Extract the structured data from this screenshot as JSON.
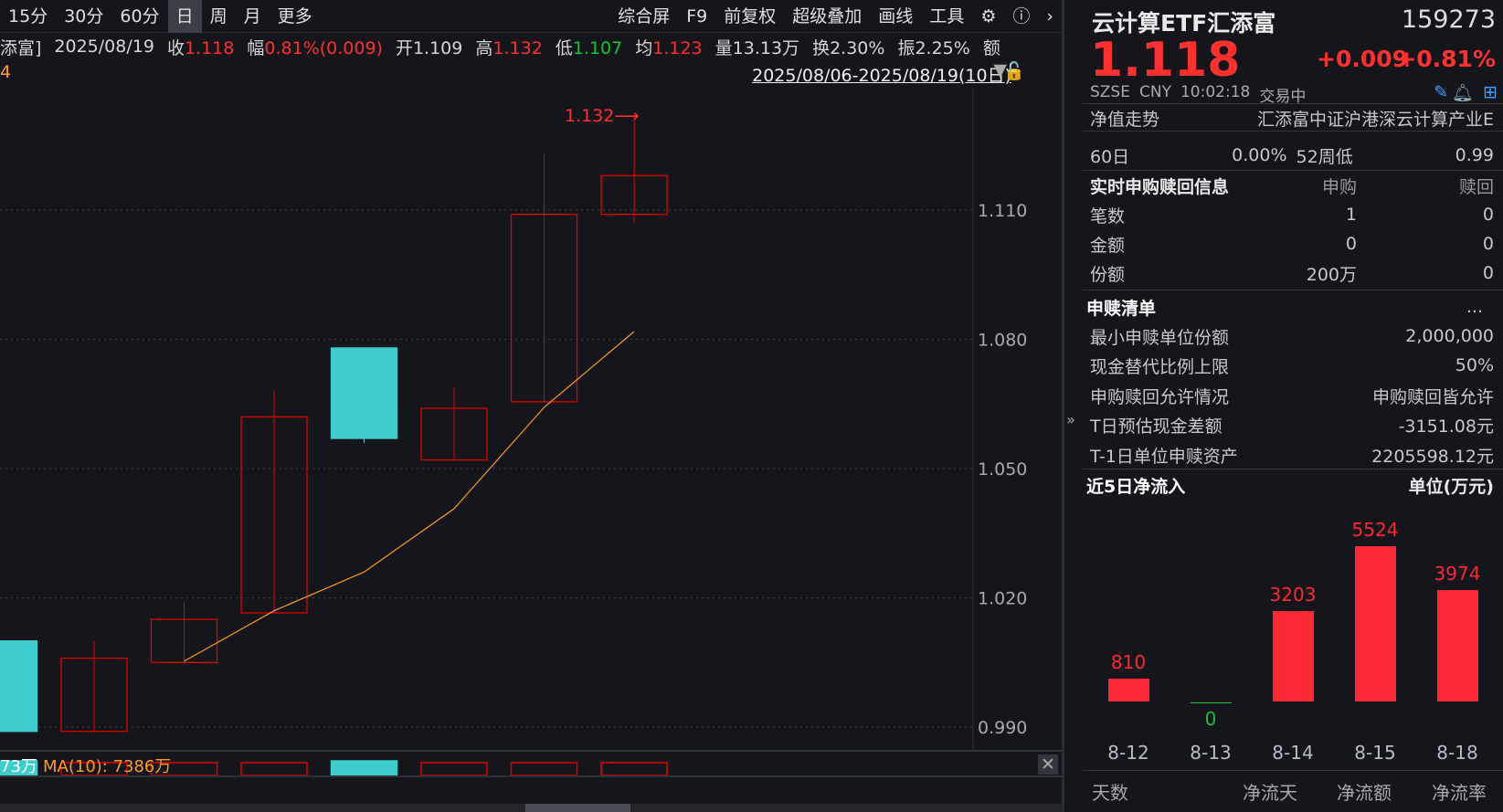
{
  "toolbar": {
    "periods": [
      "15分",
      "30分",
      "60分",
      "日",
      "周",
      "月",
      "更多"
    ],
    "active": "日",
    "right": [
      "综合屏",
      "F9",
      "前复权",
      "超级叠加",
      "画线",
      "工具"
    ],
    "icons": [
      "gear-icon",
      "help-icon",
      "chevron-right-icon"
    ]
  },
  "info": {
    "name_fragment": "添富]",
    "date": "2025/08/19",
    "close_label": "收",
    "close": "1.118",
    "change_label": "幅",
    "change": "0.81%(0.009)",
    "open_label": "开",
    "open": "1.109",
    "high_label": "高",
    "high": "1.132",
    "low_label": "低",
    "low": "1.107",
    "avg_label": "均",
    "avg": "1.123",
    "vol_label": "量",
    "vol": "13.13万",
    "turn_label": "换",
    "turn": "2.30%",
    "amp_label": "振",
    "amp": "2.25%",
    "more": "额"
  },
  "row3_left": "4",
  "date_range": "2025/08/06-2025/08/19(10日)",
  "chart_data": {
    "type": "candlestick",
    "ylim": [
      0.98,
      1.14
    ],
    "yticks": [
      "1.110",
      "1.080",
      "1.050",
      "1.020",
      "0.990"
    ],
    "ytick_values": [
      1.11,
      1.08,
      1.05,
      1.02,
      0.99
    ],
    "candles": [
      {
        "o": 1.01,
        "c": 0.989,
        "h": 1.01,
        "l": 0.989
      },
      {
        "o": 0.989,
        "c": 1.006,
        "h": 1.01,
        "l": 0.989
      },
      {
        "o": 1.005,
        "c": 1.015,
        "h": 1.019,
        "l": 1.005
      },
      {
        "o": 1.0165,
        "c": 1.062,
        "h": 1.068,
        "l": 1.0165
      },
      {
        "o": 1.078,
        "c": 1.057,
        "h": 1.078,
        "l": 1.056
      },
      {
        "o": 1.052,
        "c": 1.064,
        "h": 1.069,
        "l": 1.052
      },
      {
        "o": 1.0655,
        "c": 1.109,
        "h": 1.123,
        "l": 1.0655
      },
      {
        "o": 1.109,
        "c": 1.118,
        "h": 1.132,
        "l": 1.107
      }
    ],
    "ma": [
      null,
      null,
      1.0053,
      1.017,
      1.026,
      1.0407,
      1.0642,
      1.0818
    ],
    "high_marker": "1.132",
    "colors": {
      "up": "#e00000",
      "down": "#3ecccc",
      "ma": "#ff9a1a"
    }
  },
  "volume": {
    "value_fragment": "73万",
    "ma_label": "MA(10): 7386万"
  },
  "quote": {
    "name": "云计算ETF汇添富",
    "code": "159273",
    "price": "1.118",
    "change": "+0.009",
    "change_pct": "+0.81%",
    "exchange": "SZSE",
    "currency": "CNY",
    "time": "10:02:18",
    "status": "交易中"
  },
  "nav": {
    "label": "净值走势",
    "fund_name": "汇添富中证沪港深云计算产业E",
    "row60_label": "60日",
    "row60_value": "0.00%",
    "low52_label": "52周低",
    "low52_value": "0.99"
  },
  "realtime": {
    "title": "实时申购赎回信息",
    "col1": "申购",
    "col2": "赎回",
    "rows": [
      {
        "label": "笔数",
        "a": "1",
        "b": "0"
      },
      {
        "label": "金额",
        "a": "0",
        "b": "0"
      },
      {
        "label": "份额",
        "a": "200万",
        "b": "0"
      }
    ]
  },
  "list": {
    "title": "申赎清单",
    "more": "...",
    "rows": [
      {
        "label": "最小申赎单位份额",
        "value": "2,000,000"
      },
      {
        "label": "现金替代比例上限",
        "value": "50%"
      },
      {
        "label": "申购赎回允许情况",
        "value": "申购赎回皆允许"
      },
      {
        "label": "T日预估现金差额",
        "value": "-3151.08元"
      },
      {
        "label": "T-1日单位申赎资产",
        "value": "2205598.12元"
      }
    ]
  },
  "flow": {
    "title": "近5日净流入",
    "unit": "单位(万元)",
    "dates": [
      "8-12",
      "8-13",
      "8-14",
      "8-15",
      "8-18"
    ],
    "values": [
      810,
      0,
      3203,
      5524,
      3974
    ]
  },
  "tabs": [
    "天数",
    "净流天",
    "净流额",
    "净流率"
  ]
}
